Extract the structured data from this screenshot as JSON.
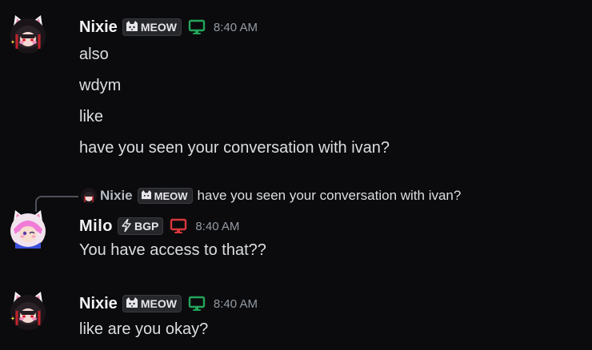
{
  "messages": [
    {
      "username": "Nixie",
      "tag": "MEOW",
      "tag_icon": "cat-icon",
      "device": "desktop-green",
      "time": "8:40 AM",
      "lines": [
        "also",
        "wdym",
        "like",
        "have you seen your conversation with ivan?"
      ]
    },
    {
      "reply": {
        "username": "Nixie",
        "tag": "MEOW",
        "text": "have you seen your conversation with ivan?"
      },
      "username": "Milo",
      "tag": "BGP",
      "tag_icon": "lightning-icon",
      "device": "desktop-red",
      "time": "8:40 AM",
      "lines": [
        "You have access to that??"
      ]
    },
    {
      "username": "Nixie",
      "tag": "MEOW",
      "tag_icon": "cat-icon",
      "device": "desktop-green",
      "time": "8:40 AM",
      "lines": [
        "like are you okay?"
      ]
    }
  ],
  "colors": {
    "background": "#0b0b0d",
    "device_green": "#23a55a",
    "device_red": "#da373c",
    "timestamp": "#949ba4"
  }
}
